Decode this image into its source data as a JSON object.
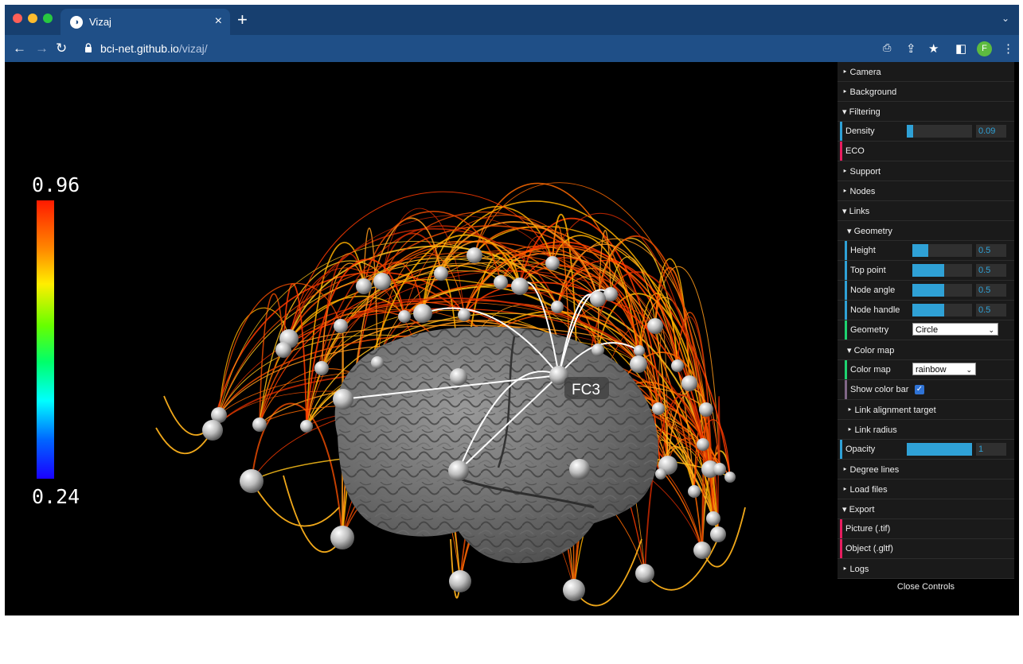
{
  "browser": {
    "tab_title": "Vizaj",
    "tab_close": "×",
    "new_tab": "+",
    "tab_menu": "⌄",
    "url_host": "bci-net.github.io",
    "url_path": "/vizaj/",
    "avatar_letter": "F"
  },
  "colorbar": {
    "max_label": "0.96",
    "min_label": "0.24",
    "colormap": "rainbow"
  },
  "scene": {
    "highlight_node_label": "FC3"
  },
  "controls": {
    "camera": "Camera",
    "background": "Background",
    "filtering": "Filtering",
    "density_label": "Density",
    "density_value": "0.09",
    "density_fraction": 0.09,
    "eco": "ECO",
    "support": "Support",
    "nodes": "Nodes",
    "links": "Links",
    "geometry_folder": "Geometry",
    "height_label": "Height",
    "height_value": "0.5",
    "top_point_label": "Top point",
    "top_point_value": "0.5",
    "node_angle_label": "Node angle",
    "node_angle_value": "0.5",
    "node_handle_label": "Node handle",
    "node_handle_value": "0.5",
    "geometry_label": "Geometry",
    "geometry_value": "Circle",
    "color_map_folder": "Color map",
    "color_map_label": "Color map",
    "color_map_value": "rainbow",
    "show_color_bar_label": "Show color bar",
    "show_color_bar_checked": true,
    "link_alignment_target": "Link alignment target",
    "link_radius": "Link radius",
    "opacity_label": "Opacity",
    "opacity_value": "1",
    "degree_lines": "Degree lines",
    "load_files": "Load files",
    "export": "Export",
    "picture": "Picture (.tif)",
    "object": "Object (.gltf)",
    "logs": "Logs",
    "close_controls": "Close Controls"
  },
  "colors": {
    "tab_bar": "#173f6f",
    "toolbar": "#1f4f87",
    "slider_fill": "#2fa1d6",
    "gui_bg": "#1a1a1a"
  }
}
